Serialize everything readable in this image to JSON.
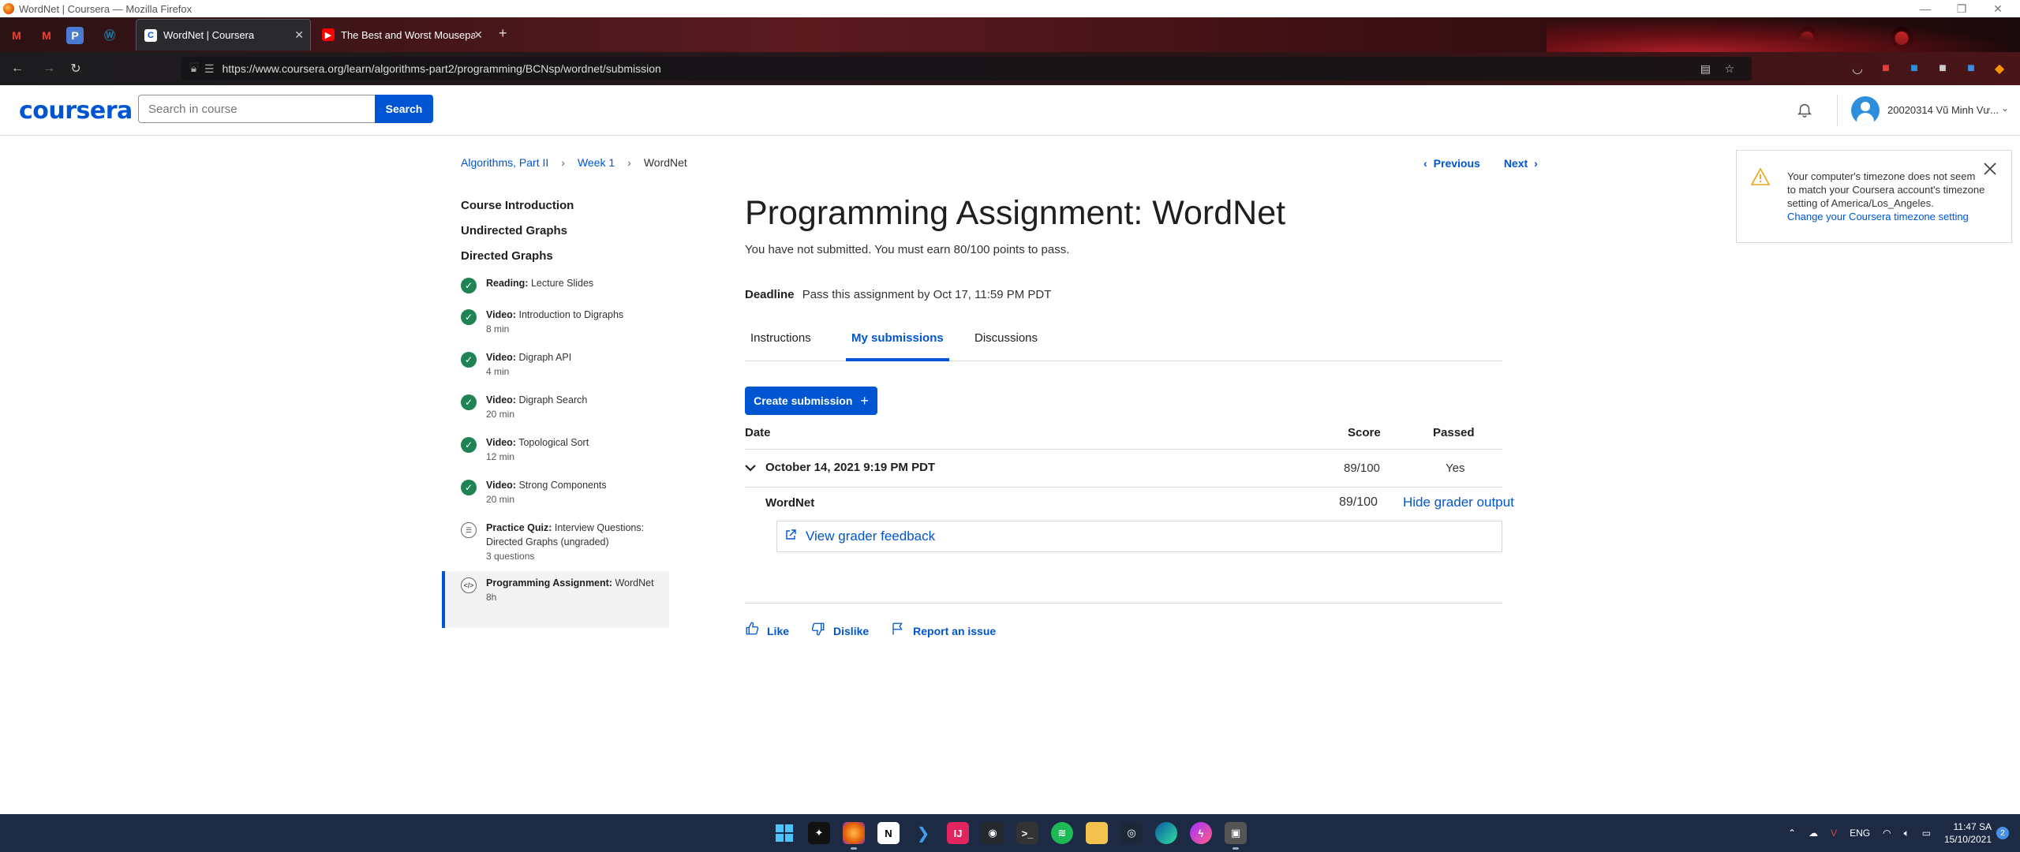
{
  "window": {
    "title": "WordNet | Coursera — Mozilla Firefox"
  },
  "browser": {
    "tabs": [
      {
        "title": "WordNet | Coursera",
        "favicon": "C",
        "active": true
      },
      {
        "title": "The Best and Worst Mousepad",
        "favicon": "▶",
        "active": false
      }
    ],
    "pinned_tabs": [
      "gmail-icon",
      "gmail-icon",
      "p-icon",
      "wordpress-icon"
    ],
    "url": "https://www.coursera.org/learn/algorithms-part2/programming/BCNsp/wordnet/submission"
  },
  "header": {
    "logo": "coursera",
    "search_placeholder": "Search in course",
    "search_button": "Search",
    "username": "20020314 Vũ Minh Vư..."
  },
  "breadcrumb": {
    "items": [
      "Algorithms, Part II",
      "Week 1"
    ],
    "current": "WordNet"
  },
  "nav": {
    "previous": "Previous",
    "next": "Next"
  },
  "sidebar": {
    "sections": [
      "Course Introduction",
      "Undirected Graphs",
      "Directed Graphs"
    ],
    "items": [
      {
        "type": "Reading:",
        "title": "Lecture Slides",
        "meta": "",
        "status": "done"
      },
      {
        "type": "Video:",
        "title": "Introduction to Digraphs",
        "meta": "8 min",
        "status": "done"
      },
      {
        "type": "Video:",
        "title": "Digraph API",
        "meta": "4 min",
        "status": "done"
      },
      {
        "type": "Video:",
        "title": "Digraph Search",
        "meta": "20 min",
        "status": "done"
      },
      {
        "type": "Video:",
        "title": "Topological Sort",
        "meta": "12 min",
        "status": "done"
      },
      {
        "type": "Video:",
        "title": "Strong Components",
        "meta": "20 min",
        "status": "done"
      },
      {
        "type": "Practice Quiz:",
        "title": "Interview Questions: Directed Graphs (ungraded)",
        "meta": "3 questions",
        "status": "quiz"
      },
      {
        "type": "Programming Assignment:",
        "title": "WordNet",
        "meta": "8h",
        "status": "active"
      }
    ]
  },
  "main": {
    "title": "Programming Assignment: WordNet",
    "pass_info": "You have not submitted. You must earn 80/100 points to pass.",
    "deadline_label": "Deadline",
    "deadline_text": "Pass this assignment by Oct 17, 11:59 PM PDT",
    "tabs": [
      {
        "label": "Instructions",
        "active": false
      },
      {
        "label": "My submissions",
        "active": true
      },
      {
        "label": "Discussions",
        "active": false
      }
    ],
    "create_submission": "Create submission",
    "table": {
      "headers": {
        "date": "Date",
        "score": "Score",
        "passed": "Passed"
      },
      "submission": {
        "date": "October 14, 2021 9:19 PM PDT",
        "score": "89/100",
        "passed": "Yes",
        "part_name": "WordNet",
        "part_score": "89/100",
        "hide_output": "Hide grader output",
        "view_feedback": "View grader feedback"
      }
    },
    "actions": {
      "like": "Like",
      "dislike": "Dislike",
      "report": "Report an issue"
    }
  },
  "timezone_notice": {
    "message": "Your computer's timezone does not seem to match your Coursera account's timezone setting of America/Los_Angeles.",
    "link": "Change your Coursera timezone setting"
  },
  "taskbar": {
    "lang": "ENG",
    "time": "11:47 SA",
    "date": "15/10/2021",
    "notifications": "2"
  },
  "colors": {
    "brand": "#0056d2",
    "success": "#1f8354",
    "warning": "#e8a317"
  }
}
